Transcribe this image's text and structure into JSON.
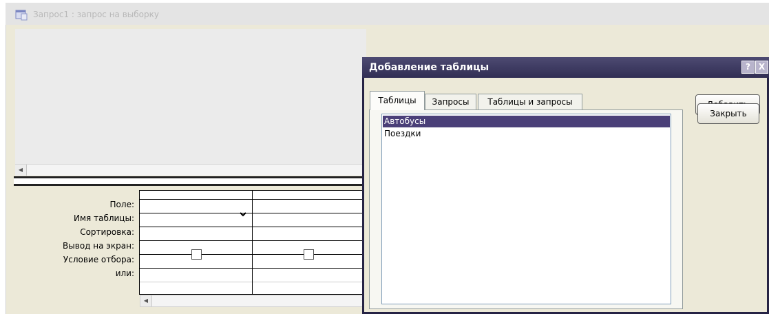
{
  "query_window": {
    "title": "Запрос1 : запрос на выборку"
  },
  "design_grid": {
    "row_labels": [
      "Поле:",
      "Имя таблицы:",
      "Сортировка:",
      "Вывод на экран:",
      "Условие отбора:",
      "или:"
    ]
  },
  "dialog": {
    "title": "Добавление таблицы",
    "help_label": "?",
    "close_label": "X",
    "tabs": [
      {
        "label": "Таблицы",
        "active": true
      },
      {
        "label": "Запросы",
        "active": false
      },
      {
        "label": "Таблицы и запросы",
        "active": false
      }
    ],
    "list_items": [
      {
        "label": "Автобусы",
        "selected": true
      },
      {
        "label": "Поездки",
        "selected": false
      }
    ],
    "add_button": "Добавить",
    "close_button": "Закрыть"
  },
  "colors": {
    "dialog_title_bg": "#3a3760",
    "selection_bg": "#4a3f78"
  }
}
